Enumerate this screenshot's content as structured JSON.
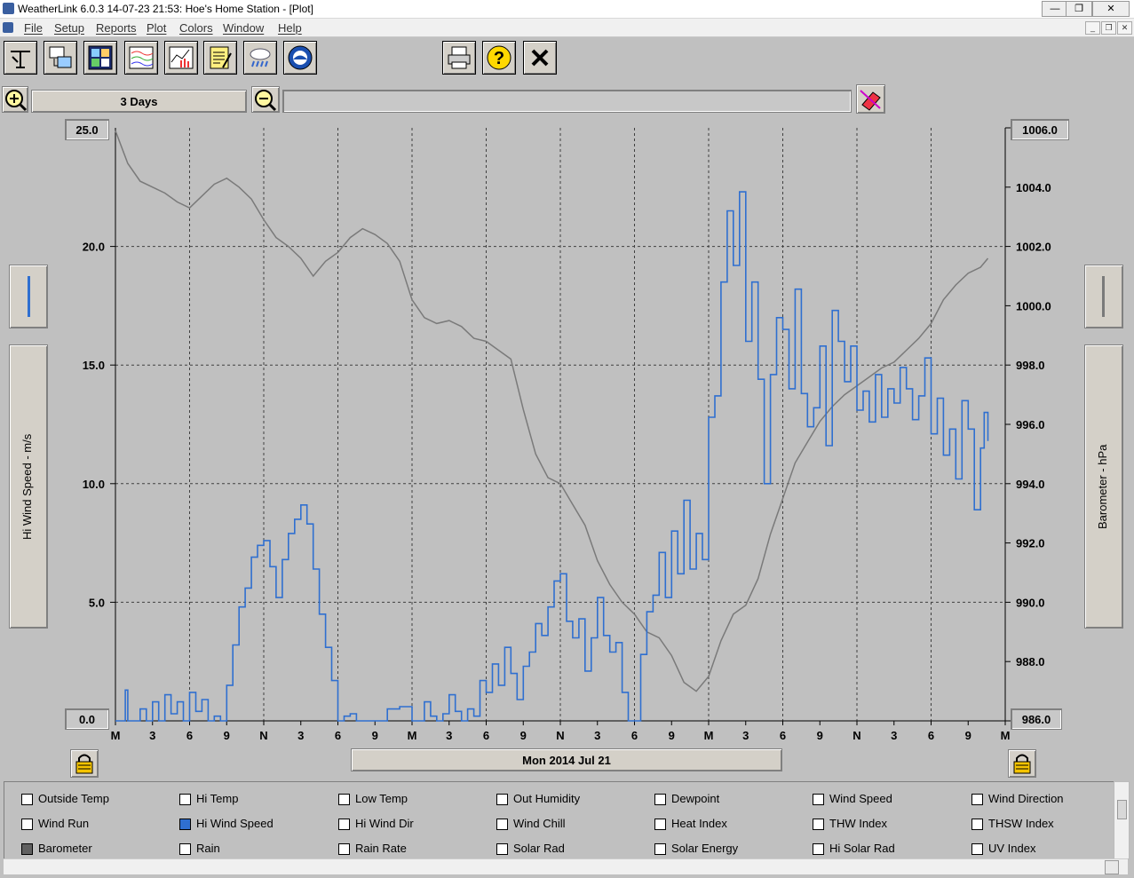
{
  "window": {
    "title": "WeatherLink 6.0.3  14-07-23  21:53: Hoe's Home Station - [Plot]"
  },
  "menu": [
    "File",
    "Setup",
    "Reports",
    "Plot",
    "Colors",
    "Window",
    "Help"
  ],
  "toolbar": {
    "icons": [
      "station-icon",
      "download-icon",
      "bulletin-icon",
      "strip-chart-icon",
      "graph-icon",
      "notepad-icon",
      "weather-icon",
      "noaa-icon"
    ],
    "right_icons": [
      "print-icon",
      "help-icon",
      "close-icon"
    ]
  },
  "span": {
    "label": "3 Days"
  },
  "plot_date": "Mon 2014 Jul 21",
  "axes": {
    "left_label": "Hi Wind Speed - m/s",
    "right_label": "Barometer - hPa",
    "left_ticks": [
      "25.0",
      "20.0",
      "15.0",
      "10.0",
      "5.0",
      "0.0"
    ],
    "right_ticks": [
      "1006.0",
      "1004.0",
      "1002.0",
      "1000.0",
      "998.0",
      "996.0",
      "994.0",
      "992.0",
      "990.0",
      "988.0",
      "986.0"
    ],
    "x_ticks": [
      "M",
      "3",
      "6",
      "9",
      "N",
      "3",
      "6",
      "9",
      "M",
      "3",
      "6",
      "9",
      "N",
      "3",
      "6",
      "9",
      "M",
      "3",
      "6",
      "9",
      "N",
      "3",
      "6",
      "9",
      "M"
    ]
  },
  "legend": {
    "items": [
      {
        "label": "Outside Temp",
        "state": "off"
      },
      {
        "label": "Hi Temp",
        "state": "off"
      },
      {
        "label": "Low Temp",
        "state": "off"
      },
      {
        "label": "Out Humidity",
        "state": "off"
      },
      {
        "label": "Dewpoint",
        "state": "off"
      },
      {
        "label": "Wind Speed",
        "state": "off"
      },
      {
        "label": "Wind Direction",
        "state": "off"
      },
      {
        "label": "Wind Run",
        "state": "off"
      },
      {
        "label": "Hi Wind Speed",
        "state": "on-blue"
      },
      {
        "label": "Hi Wind Dir",
        "state": "off"
      },
      {
        "label": "Wind Chill",
        "state": "off"
      },
      {
        "label": "Heat Index",
        "state": "off"
      },
      {
        "label": "THW Index",
        "state": "off"
      },
      {
        "label": "THSW Index",
        "state": "off"
      },
      {
        "label": "Barometer",
        "state": "on-gray"
      },
      {
        "label": "Rain",
        "state": "off"
      },
      {
        "label": "Rain Rate",
        "state": "off"
      },
      {
        "label": "Solar Rad",
        "state": "off"
      },
      {
        "label": "Solar Energy",
        "state": "off"
      },
      {
        "label": "Hi Solar Rad",
        "state": "off"
      },
      {
        "label": "UV Index",
        "state": "off"
      }
    ]
  },
  "colors": {
    "wind": "#2f6fd0",
    "barometer": "#7a7a7a",
    "grid": "#404040",
    "background": "#c0c0c0"
  },
  "chart_data": {
    "type": "line",
    "title": "",
    "xlabel": "",
    "x_range_hours": [
      0,
      72
    ],
    "left_axis": {
      "label": "Hi Wind Speed - m/s",
      "ylim": [
        0,
        25
      ]
    },
    "right_axis": {
      "label": "Barometer - hPa",
      "ylim": [
        986,
        1006
      ]
    },
    "series": [
      {
        "name": "Hi Wind Speed",
        "axis": "left",
        "x": [
          0,
          0.8,
          1,
          1.5,
          2,
          2.5,
          3,
          3.5,
          4,
          4.5,
          5,
          5.5,
          6,
          6.5,
          7,
          7.5,
          8,
          8.5,
          9,
          9.5,
          10,
          10.5,
          11,
          11.5,
          12,
          12.5,
          13,
          13.5,
          14,
          14.5,
          15,
          15.5,
          16,
          16.5,
          17,
          17.5,
          18,
          18.5,
          19,
          19.5,
          20,
          21,
          22,
          23,
          24,
          24.5,
          25,
          25.5,
          26,
          26.5,
          27,
          27.5,
          28,
          28.5,
          29,
          29.5,
          30,
          30.5,
          31,
          31.5,
          32,
          32.5,
          33,
          33.5,
          34,
          34.5,
          35,
          35.5,
          36,
          36.5,
          37,
          37.5,
          38,
          38.5,
          39,
          39.5,
          40,
          40.5,
          41,
          41.5,
          42,
          42.5,
          43,
          43.5,
          44,
          44.5,
          45,
          45.5,
          46,
          46.5,
          47,
          47.5,
          48,
          48.5,
          49,
          49.5,
          50,
          50.5,
          51,
          51.5,
          52,
          52.5,
          53,
          53.5,
          54,
          54.5,
          55,
          55.5,
          56,
          56.5,
          57,
          57.5,
          58,
          58.5,
          59,
          59.5,
          60,
          60.5,
          61,
          61.5,
          62,
          62.5,
          63,
          63.5,
          64,
          64.5,
          65,
          65.5,
          66,
          66.5,
          67,
          67.5,
          68,
          68.5,
          69,
          69.5,
          70,
          70.3,
          70.6
        ],
        "y": [
          0,
          1.3,
          0,
          0,
          0.5,
          0,
          0.8,
          0,
          1.1,
          0.3,
          0.8,
          0,
          1.2,
          0.4,
          0.9,
          0,
          0.2,
          0,
          1.5,
          3.2,
          4.8,
          5.6,
          6.9,
          7.4,
          7.6,
          6.5,
          5.2,
          6.8,
          7.9,
          8.5,
          9.1,
          8.3,
          6.4,
          4.5,
          3.1,
          1.7,
          0,
          0.2,
          0.3,
          0,
          0,
          0,
          0.5,
          0.6,
          0,
          0,
          0.8,
          0.2,
          0,
          0.3,
          1.1,
          0.4,
          0,
          0.5,
          0.2,
          1.7,
          1.2,
          2.4,
          1.5,
          3.1,
          2.0,
          0.9,
          2.3,
          2.9,
          4.1,
          3.6,
          4.8,
          5.9,
          6.2,
          4.2,
          3.5,
          4.3,
          2.1,
          3.5,
          5.2,
          3.6,
          2.9,
          3.3,
          1.2,
          0,
          0,
          2.8,
          4.6,
          5.3,
          7.1,
          5.2,
          8.0,
          6.2,
          9.3,
          6.4,
          7.9,
          6.8,
          12.8,
          13.7,
          18.5,
          21.5,
          19.2,
          22.3,
          16.0,
          18.5,
          14.4,
          10.0,
          14.6,
          17.0,
          16.5,
          14.0,
          18.2,
          13.8,
          12.4,
          13.2,
          15.8,
          11.6,
          17.3,
          16.0,
          14.3,
          15.8,
          13.1,
          13.9,
          12.6,
          14.6,
          12.8,
          14.0,
          13.4,
          14.9,
          14.0,
          12.7,
          13.7,
          15.3,
          12.1,
          13.6,
          11.2,
          12.3,
          10.2,
          13.5,
          12.3,
          8.9,
          11.5,
          13.0,
          11.8
        ]
      },
      {
        "name": "Barometer",
        "axis": "right",
        "x": [
          0,
          1,
          2,
          3,
          4,
          5,
          6,
          7,
          8,
          9,
          10,
          11,
          12,
          13,
          14,
          15,
          16,
          17,
          18,
          19,
          20,
          21,
          22,
          23,
          24,
          25,
          26,
          27,
          28,
          29,
          30,
          31,
          32,
          33,
          34,
          35,
          36,
          37,
          38,
          39,
          40,
          41,
          42,
          43,
          44,
          45,
          46,
          47,
          48,
          49,
          50,
          51,
          52,
          53,
          54,
          55,
          56,
          57,
          58,
          59,
          60,
          61,
          62,
          63,
          64,
          65,
          66,
          67,
          68,
          69,
          70,
          70.6
        ],
        "y": [
          1005.9,
          1004.8,
          1004.2,
          1004.0,
          1003.8,
          1003.5,
          1003.3,
          1003.7,
          1004.1,
          1004.3,
          1004.0,
          1003.6,
          1002.9,
          1002.3,
          1002.0,
          1001.6,
          1001.0,
          1001.5,
          1001.8,
          1002.3,
          1002.6,
          1002.4,
          1002.1,
          1001.5,
          1000.2,
          999.6,
          999.4,
          999.5,
          999.3,
          998.9,
          998.8,
          998.5,
          998.2,
          996.5,
          995.0,
          994.2,
          994.0,
          993.3,
          992.6,
          991.4,
          990.6,
          990.0,
          989.6,
          989.0,
          988.8,
          988.2,
          987.3,
          987.0,
          987.5,
          988.7,
          989.6,
          989.9,
          990.8,
          992.3,
          993.5,
          994.7,
          995.4,
          996.1,
          996.6,
          997.0,
          997.3,
          997.6,
          997.9,
          998.1,
          998.5,
          998.9,
          999.4,
          1000.2,
          1000.7,
          1001.1,
          1001.3,
          1001.6
        ]
      }
    ],
    "x_ticks": [
      "M",
      "3",
      "6",
      "9",
      "N",
      "3",
      "6",
      "9",
      "M",
      "3",
      "6",
      "9",
      "N",
      "3",
      "6",
      "9",
      "M",
      "3",
      "6",
      "9",
      "N",
      "3",
      "6",
      "9",
      "M"
    ],
    "grid": true
  }
}
